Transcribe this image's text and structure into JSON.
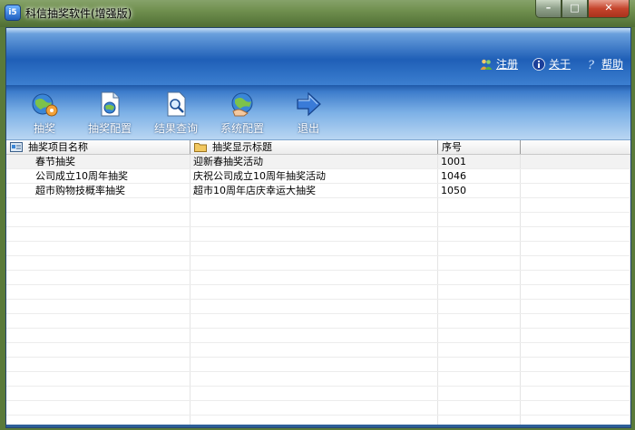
{
  "window": {
    "title": "科信抽奖软件(增强版)",
    "icon": "app-logo-icon",
    "controls": {
      "minimize": "–",
      "maximize": "□",
      "close": "✕"
    }
  },
  "banner": {
    "links": [
      {
        "label": "注册",
        "icon": "users-icon"
      },
      {
        "label": "关于",
        "icon": "info-icon"
      },
      {
        "label": "帮助",
        "icon": "help-icon"
      }
    ]
  },
  "toolbar": {
    "items": [
      {
        "label": "抽奖",
        "icon": "globe-gear-icon"
      },
      {
        "label": "抽奖配置",
        "icon": "document-globe-icon"
      },
      {
        "label": "结果查询",
        "icon": "search-document-icon"
      },
      {
        "label": "系统配置",
        "icon": "globe-hand-icon"
      },
      {
        "label": "退出",
        "icon": "arrow-right-icon"
      }
    ]
  },
  "table": {
    "columns": [
      "抽奖项目名称",
      "抽奖显示标题",
      "序号",
      ""
    ],
    "rows": [
      [
        "春节抽奖",
        "迎新春抽奖活动",
        "1001",
        ""
      ],
      [
        "公司成立10周年抽奖",
        "庆祝公司成立10周年抽奖活动",
        "1046",
        ""
      ],
      [
        "超市购物技概率抽奖",
        "超市10周年店庆幸运大抽奖",
        "1050",
        ""
      ]
    ]
  },
  "colors": {
    "banner": "#1f5fb7",
    "toolbar": "#7cb0e6",
    "link_text": "#ffffff"
  }
}
